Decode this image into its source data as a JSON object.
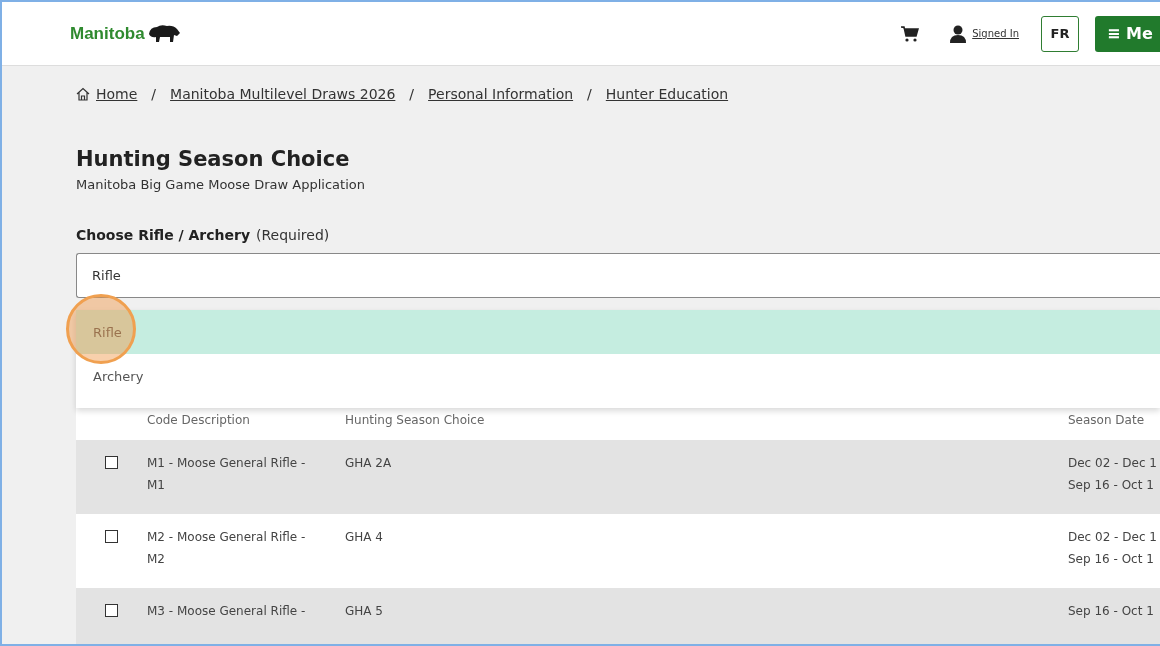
{
  "header": {
    "logo": "Manitoba",
    "signed_in": "Signed In",
    "language_button": "FR",
    "menu_button": {
      "icon": "≡",
      "label": "Me"
    }
  },
  "breadcrumb_separator": "/",
  "breadcrumb": [
    "Home",
    "Manitoba Multilevel Draws 2026",
    "Personal Information",
    "Hunter Education"
  ],
  "page": {
    "title": "Hunting Season Choice",
    "subtitle": "Manitoba Big Game Moose Draw Application"
  },
  "field": {
    "label": "Choose Rifle / Archery",
    "required": "(Required)",
    "value": "Rifle"
  },
  "options": [
    {
      "label": "Rifle",
      "selected": true
    },
    {
      "label": "Archery",
      "selected": false
    }
  ],
  "table": {
    "columns": [
      "Code Description",
      "Hunting Season Choice",
      "Season Date"
    ],
    "rows": [
      {
        "checked": false,
        "code": [
          "M1 - Moose General Rifle -",
          "M1"
        ],
        "choice": "GHA 2A",
        "dates": [
          "Dec 02 - Dec 1",
          "Sep 16 - Oct 1"
        ]
      },
      {
        "checked": false,
        "code": [
          "M2 - Moose General Rifle -",
          "M2"
        ],
        "choice": "GHA 4",
        "dates": [
          "Dec 02 - Dec 1",
          "Sep 16 - Oct 1"
        ]
      },
      {
        "checked": false,
        "code": [
          "M3 - Moose General Rifle -"
        ],
        "choice": "GHA 5",
        "dates": [
          "Sep 16 - Oct 1"
        ]
      }
    ]
  }
}
